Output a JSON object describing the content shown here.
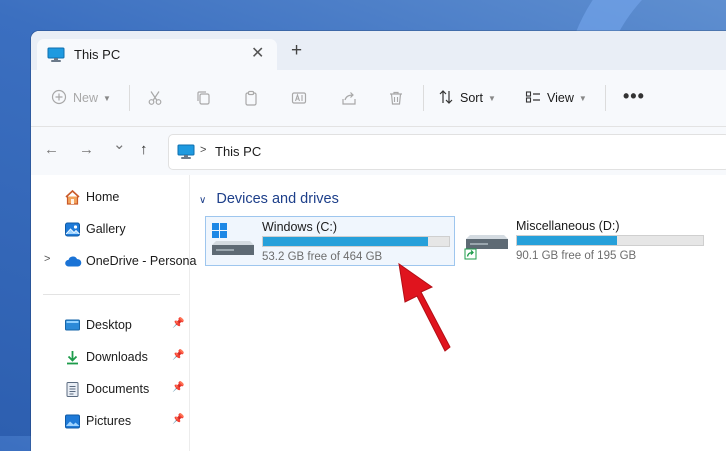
{
  "window": {
    "tab_title": "This PC",
    "tab_icon": "monitor-icon",
    "close_glyph": "✕",
    "new_tab_glyph": "+"
  },
  "toolbar": {
    "new_label": "New",
    "sort_label": "Sort",
    "view_label": "View",
    "more_glyph": "•••",
    "icons": [
      "cut-icon",
      "copy-icon",
      "paste-icon",
      "rename-icon",
      "share-icon",
      "delete-icon"
    ]
  },
  "address": {
    "back_glyph": "←",
    "forward_glyph": "→",
    "recent_glyph": "⌄",
    "up_glyph": "↑",
    "path": "This PC"
  },
  "sidebar": {
    "items": [
      {
        "label": "Home",
        "icon": "home-icon"
      },
      {
        "label": "Gallery",
        "icon": "gallery-icon"
      },
      {
        "label": "OneDrive - Persona",
        "icon": "cloud-icon"
      },
      {
        "label": "Desktop",
        "icon": "desktop-folder-icon"
      },
      {
        "label": "Downloads",
        "icon": "download-icon"
      },
      {
        "label": "Documents",
        "icon": "documents-icon"
      },
      {
        "label": "Pictures",
        "icon": "pictures-icon"
      }
    ]
  },
  "main": {
    "section_title": "Devices and drives",
    "drives": [
      {
        "name": "Windows (C:)",
        "free_text": "53.2 GB free of 464 GB",
        "used_fraction": 0.885,
        "icon": "windows-drive-icon"
      },
      {
        "name": "Miscellaneous  (D:)",
        "free_text": "90.1 GB free of 195 GB",
        "used_fraction": 0.538,
        "icon": "drive-icon"
      }
    ]
  },
  "colors": {
    "accent": "#26a0da",
    "section_title": "#1d3f8a",
    "annotation_arrow": "#e0141e"
  }
}
